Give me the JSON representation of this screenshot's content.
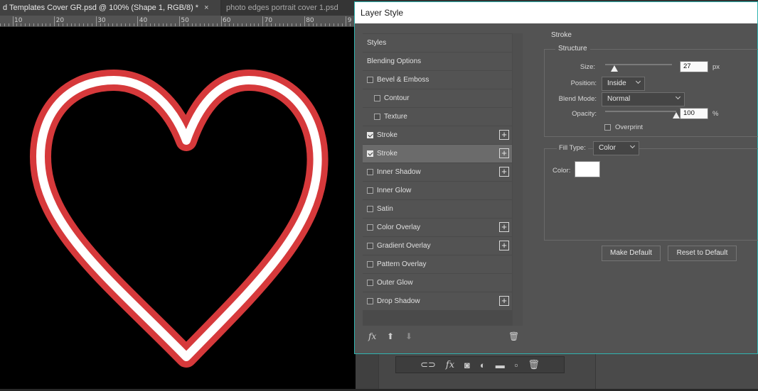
{
  "tabs": [
    {
      "label": "d Templates Cover GR.psd @ 100% (Shape 1, RGB/8) *",
      "close": "×",
      "active": true
    },
    {
      "label": "photo edges portrait cover 1.psd",
      "active": false
    }
  ],
  "ruler": {
    "numbers": [
      "10",
      "20",
      "30",
      "40",
      "50",
      "60",
      "70",
      "80",
      "9"
    ]
  },
  "canvas": {
    "heart_outer_color": "#d6393b",
    "heart_inner_color": "#ffffff",
    "background": "#000000"
  },
  "dialog": {
    "title": "Layer Style",
    "styles": [
      {
        "label": "Styles",
        "checkbox": null,
        "indent": 0,
        "plus": false,
        "selected": false
      },
      {
        "label": "Blending Options",
        "checkbox": null,
        "indent": 0,
        "plus": false,
        "selected": false
      },
      {
        "label": "Bevel & Emboss",
        "checkbox": false,
        "indent": 0,
        "plus": false,
        "selected": false
      },
      {
        "label": "Contour",
        "checkbox": false,
        "indent": 1,
        "plus": false,
        "selected": false
      },
      {
        "label": "Texture",
        "checkbox": false,
        "indent": 1,
        "plus": false,
        "selected": false
      },
      {
        "label": "Stroke",
        "checkbox": true,
        "indent": 0,
        "plus": true,
        "selected": false
      },
      {
        "label": "Stroke",
        "checkbox": true,
        "indent": 0,
        "plus": true,
        "selected": true
      },
      {
        "label": "Inner Shadow",
        "checkbox": false,
        "indent": 0,
        "plus": true,
        "selected": false
      },
      {
        "label": "Inner Glow",
        "checkbox": false,
        "indent": 0,
        "plus": false,
        "selected": false
      },
      {
        "label": "Satin",
        "checkbox": false,
        "indent": 0,
        "plus": false,
        "selected": false
      },
      {
        "label": "Color Overlay",
        "checkbox": false,
        "indent": 0,
        "plus": true,
        "selected": false
      },
      {
        "label": "Gradient Overlay",
        "checkbox": false,
        "indent": 0,
        "plus": true,
        "selected": false
      },
      {
        "label": "Pattern Overlay",
        "checkbox": false,
        "indent": 0,
        "plus": false,
        "selected": false
      },
      {
        "label": "Outer Glow",
        "checkbox": false,
        "indent": 0,
        "plus": false,
        "selected": false
      },
      {
        "label": "Drop Shadow",
        "checkbox": false,
        "indent": 0,
        "plus": true,
        "selected": false
      }
    ],
    "footer": {
      "fx": "fx",
      "up": "⬆",
      "down": "⬇",
      "trash": "🗑"
    },
    "stroke": {
      "section_title": "Stroke",
      "structure_title": "Structure",
      "size_label": "Size:",
      "size_value": "27",
      "size_unit": "px",
      "size_slider_fraction": 0.14,
      "position_label": "Position:",
      "position_value": "Inside",
      "blend_label": "Blend Mode:",
      "blend_value": "Normal",
      "opacity_label": "Opacity:",
      "opacity_value": "100",
      "opacity_unit": "%",
      "opacity_slider_fraction": 1.0,
      "overprint_label": "Overprint",
      "overprint_checked": false,
      "fill_type_label": "Fill Type:",
      "fill_type_value": "Color",
      "color_label": "Color:",
      "color_value": "#ffffff",
      "make_default": "Make Default",
      "reset_default": "Reset to Default"
    }
  },
  "layers_toolbar": {
    "icons": [
      "link-icon",
      "fx-icon",
      "mask-icon",
      "adjustment-icon",
      "folder-icon",
      "new-layer-icon",
      "trash-icon"
    ]
  }
}
